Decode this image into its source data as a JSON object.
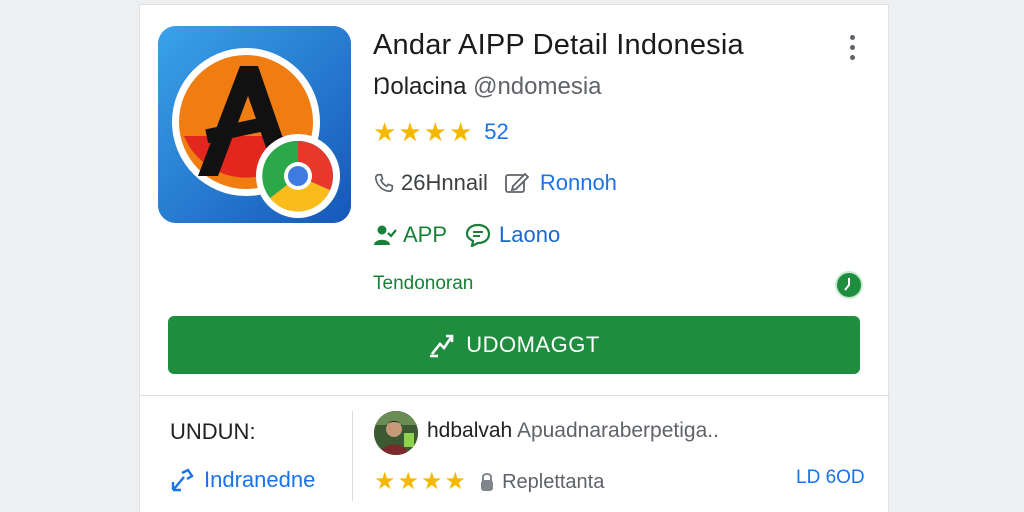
{
  "app": {
    "title": "Andar AIPP Detail Indonesia",
    "developer_prefix": "Ŋolacina",
    "developer_handle": "@ndomesia",
    "rating_stars": 4,
    "rating_count": "52",
    "size": "26Hnnail",
    "info_link": "Ronnoh",
    "badge_app": "APP",
    "badge_lang": "Laono",
    "category": "Tendonoran",
    "install_label": "UDOMAGGT"
  },
  "footer": {
    "section_label": "UNDUN:",
    "language_link": "Indranedne",
    "review": {
      "author": "hdbalvah",
      "text": "Apuadnaraberpetiga..",
      "stars": 4,
      "reply_label": "Replettanta",
      "count_label": "LD 6OD"
    }
  },
  "colors": {
    "install_green": "#1e8e3e",
    "link_blue": "#1a73e8",
    "star_yellow": "#f5b800"
  },
  "icons": [
    "app-logo-icon",
    "more-vert-icon",
    "phone-icon",
    "edit-icon",
    "user-check-icon",
    "chat-icon",
    "verified-icon",
    "download-icon",
    "link-icon",
    "lock-icon"
  ]
}
